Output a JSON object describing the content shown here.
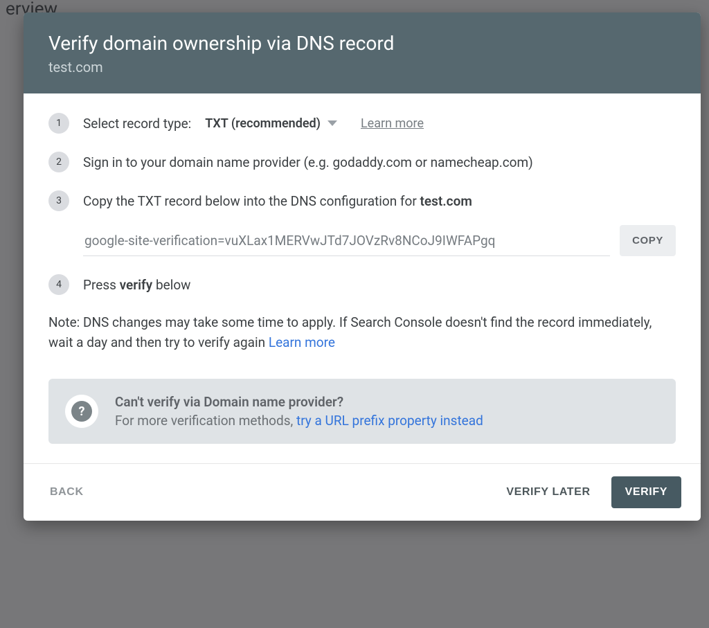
{
  "background": {
    "page_hint": "erview"
  },
  "dialog": {
    "title": "Verify domain ownership via DNS record",
    "domain": "test.com",
    "steps": {
      "s1": {
        "num": "1",
        "label": "Select record type:",
        "selected_value": "TXT (recommended)",
        "learn_more": "Learn more"
      },
      "s2": {
        "num": "2",
        "text": "Sign in to your domain name provider (e.g. godaddy.com or namecheap.com)"
      },
      "s3": {
        "num": "3",
        "prefix": "Copy the TXT record below into the DNS configuration for ",
        "domain": "test.com",
        "txt_value": "google-site-verification=vuXLax1MERVwJTd7JOVzRv8NCoJ9IWFAPgq",
        "copy_label": "COPY"
      },
      "s4": {
        "num": "4",
        "prefix": "Press ",
        "bold": "verify",
        "suffix": " below"
      }
    },
    "note": {
      "text": "Note: DNS changes may take some time to apply. If Search Console doesn't find the record immediately, wait a day and then try to verify again ",
      "learn_more": "Learn more"
    },
    "alt": {
      "title": "Can't verify via Domain name provider?",
      "subtitle_prefix": "For more verification methods, ",
      "subtitle_link": "try a URL prefix property instead"
    },
    "actions": {
      "back": "BACK",
      "verify_later": "VERIFY LATER",
      "verify": "VERIFY"
    }
  }
}
